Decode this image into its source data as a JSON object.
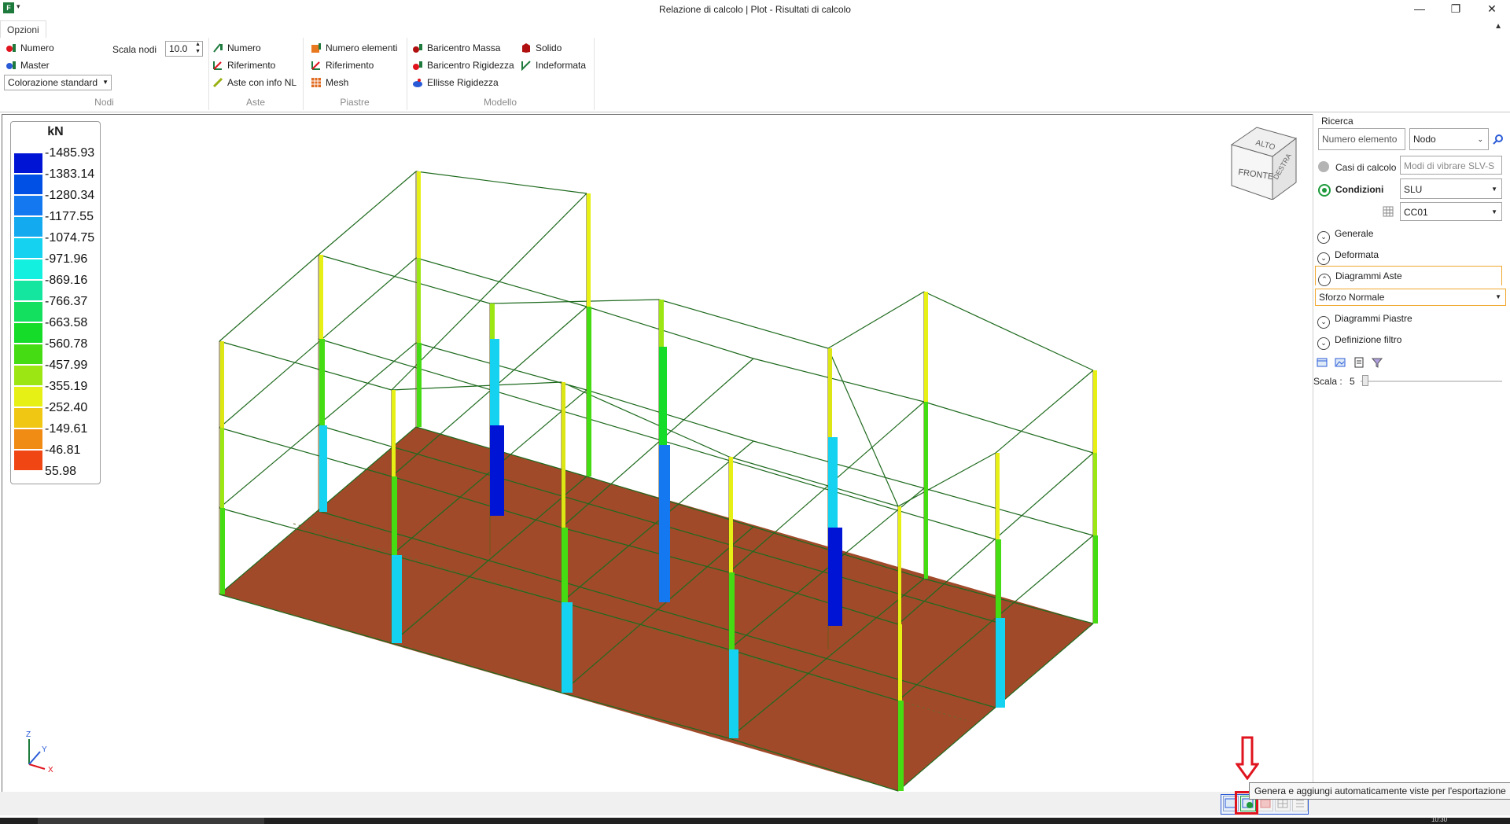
{
  "window": {
    "title": "Relazione di calcolo | Plot - Risultati di calcolo",
    "app_icon": "F"
  },
  "tabs": [
    {
      "label": "Opzioni"
    }
  ],
  "ribbon": {
    "nodi": {
      "title": "Nodi",
      "numero": "Numero",
      "master": "Master",
      "scala_label": "Scala nodi",
      "scala_value": "10.0",
      "colorazione": "Colorazione standard"
    },
    "aste": {
      "title": "Aste",
      "numero": "Numero",
      "riferimento": "Riferimento",
      "info_nl": "Aste con info NL"
    },
    "piastre": {
      "title": "Piastre",
      "numero_elementi": "Numero elementi",
      "riferimento": "Riferimento",
      "mesh": "Mesh"
    },
    "modello": {
      "title": "Modello",
      "baricentro_massa": "Baricentro Massa",
      "baricentro_rigidezza": "Baricentro Rigidezza",
      "ellisse": "Ellisse Rigidezza",
      "solido": "Solido",
      "indeformata": "Indeformata"
    }
  },
  "legend": {
    "unit": "kN",
    "entries": [
      {
        "value": "-1485.93",
        "color": "#0014d6"
      },
      {
        "value": "-1383.14",
        "color": "#0050e6"
      },
      {
        "value": "-1280.34",
        "color": "#1478f0"
      },
      {
        "value": "-1177.55",
        "color": "#14aaf0"
      },
      {
        "value": "-1074.75",
        "color": "#14d2f0"
      },
      {
        "value": "-971.96",
        "color": "#14f0e0"
      },
      {
        "value": "-869.16",
        "color": "#14e6a0"
      },
      {
        "value": "-766.37",
        "color": "#14e060"
      },
      {
        "value": "-663.58",
        "color": "#14dc28"
      },
      {
        "value": "-560.78",
        "color": "#46dc14"
      },
      {
        "value": "-457.99",
        "color": "#9ce614"
      },
      {
        "value": "-355.19",
        "color": "#e6f014"
      },
      {
        "value": "-252.40",
        "color": "#f0c814"
      },
      {
        "value": "-149.61",
        "color": "#f08c14"
      },
      {
        "value": "-46.81",
        "color": "#f04614"
      },
      {
        "value": "55.98",
        "color": ""
      }
    ]
  },
  "viewcube": {
    "top": "ALTO",
    "front": "FRONTE",
    "right": "DESTRA"
  },
  "axes": {
    "z": "Z",
    "y": "Y",
    "x": "X"
  },
  "panel": {
    "ricerca": "Ricerca",
    "numero_placeholder": "Numero elemento",
    "nodo": "Nodo",
    "casi_label": "Casi di calcolo",
    "casi_value": "Modi di vibrare SLV-S",
    "condizioni_label": "Condizioni",
    "condizioni_value": "SLU",
    "combo_value": "CC01",
    "generale": "Generale",
    "deformata": "Deformata",
    "diagrammi_aste": "Diagrammi Aste",
    "sforzo": "Sforzo Normale",
    "diagrammi_piastre": "Diagrammi Piastre",
    "filtro": "Definizione filtro",
    "scala_label": "Scala :",
    "scala_value": "5"
  },
  "tooltip": "Genera e aggiungi automaticamente viste per l'esportazione",
  "clock": "10:30"
}
